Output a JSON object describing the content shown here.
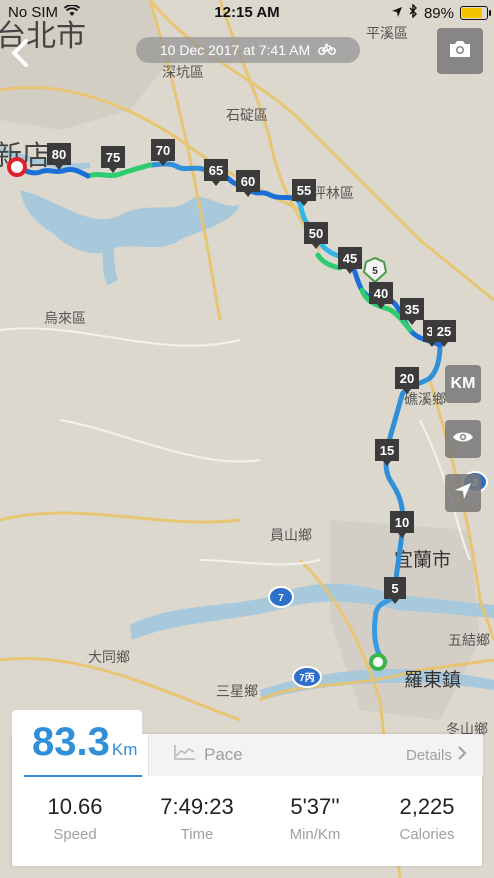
{
  "status_bar": {
    "carrier": "No SIM",
    "time": "12:15 AM",
    "battery": "89%",
    "battery_level": 0.89
  },
  "header": {
    "date": "10 Dec 2017 at 7:41 AM"
  },
  "map": {
    "places": [
      "台北市",
      "新店",
      "平溪區",
      "深坑區",
      "石碇區",
      "坪林區",
      "烏來區",
      "礁溪鄉",
      "員山鄉",
      "宜蘭市",
      "大同鄉",
      "三星鄉",
      "五結鄉",
      "羅東鎮",
      "冬山鄉"
    ],
    "road_shields": [
      "5",
      "7",
      "7丙",
      "2"
    ],
    "km_markers": [
      "80",
      "75",
      "70",
      "65",
      "60",
      "55",
      "50",
      "45",
      "40",
      "35",
      "3",
      "25",
      "20",
      "15",
      "10",
      "5"
    ]
  },
  "controls": {
    "unit_toggle": "KM"
  },
  "summary": {
    "distance": "83.3",
    "distance_unit": "Km",
    "tab_label": "Pace",
    "details_label": "Details",
    "stats": [
      {
        "value": "10.66",
        "label": "Speed"
      },
      {
        "value": "7:49:23",
        "label": "Time"
      },
      {
        "value": "5'37''",
        "label": "Min/Km"
      },
      {
        "value": "2,225",
        "label": "Calories"
      }
    ]
  }
}
